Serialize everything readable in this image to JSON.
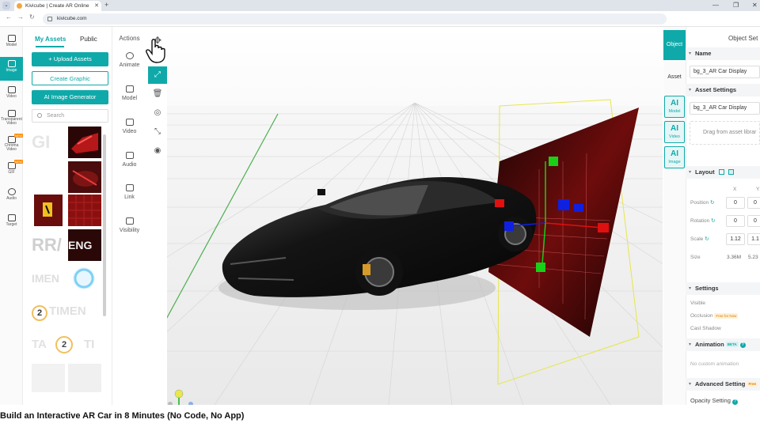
{
  "browser": {
    "tab_title": "Kivicube | Create AR Online",
    "new_tab": "+",
    "url": "kivicube.com"
  },
  "rail": {
    "items": [
      {
        "label": "Model",
        "icon": "cube-icon"
      },
      {
        "label": "Image",
        "icon": "image-icon"
      },
      {
        "label": "Video",
        "icon": "ar-video-icon"
      },
      {
        "label": "Transparent Video",
        "icon": "transparent-video-icon"
      },
      {
        "label": "Chroma Video",
        "icon": "chroma-video-icon",
        "badge": "NEW"
      },
      {
        "label": "GIF",
        "icon": "gif-icon",
        "badge": "NEW"
      },
      {
        "label": "Audio",
        "icon": "music-icon"
      },
      {
        "label": "Target",
        "icon": "target-icon"
      }
    ]
  },
  "assets": {
    "tabs": [
      "My Assets",
      "Public"
    ],
    "upload": "+ Upload Assets",
    "create_graphic": "Create Graphic",
    "ai_generator": "AI Image Generator",
    "search_placeholder": "Search",
    "thumbs": [
      "GI",
      "",
      "",
      "",
      "",
      "",
      "RR/",
      "ENG",
      "IMEN",
      "",
      "2",
      "TIMEN",
      "TA",
      "2",
      "TI",
      "",
      ""
    ]
  },
  "actions": {
    "title": "Actions",
    "items": [
      "Animate",
      "Model",
      "Video",
      "Audio",
      "Link",
      "Visibility"
    ]
  },
  "right": {
    "tabs": [
      "Object",
      "Asset"
    ],
    "ai_tiles": [
      {
        "title": "AI",
        "label": "Model"
      },
      {
        "title": "AI",
        "label": "Video"
      },
      {
        "title": "AI",
        "label": "Image"
      }
    ],
    "header": "Object Set",
    "name_section": "Name",
    "name_value": "bg_3_AR Car Display",
    "asset_section": "Asset Settings",
    "asset_value": "bg_3_AR Car Display",
    "drag_hint": "Drag from asset librar",
    "layout_section": "Layout",
    "col_x": "X",
    "col_y": "Y",
    "position_label": "Position",
    "position_x": "0",
    "position_y": "0",
    "rotation_label": "Rotation",
    "rotation_x": "0",
    "rotation_y": "0",
    "scale_label": "Scale",
    "scale_x": "1.12",
    "scale_y": "1.1",
    "size_label": "Size",
    "size_x": "3.36M",
    "size_y": "5.23",
    "settings_section": "Settings",
    "visible": "Visible",
    "occlusion": "Occlusion",
    "free_badge": "Free for Now",
    "cast_shadow": "Cast Shadow",
    "animation_section": "Animation",
    "beta_badge": "BETA",
    "no_anim": "No custom animation",
    "advanced_section": "Advanced Setting",
    "advanced_badge": "Free",
    "opacity": "Opacity Setting"
  },
  "caption": "Build an Interactive AR Car in 8 Minutes (No Code, No App)",
  "colors": {
    "accent": "#10a9a9",
    "badge_orange": "#ff8a00"
  }
}
